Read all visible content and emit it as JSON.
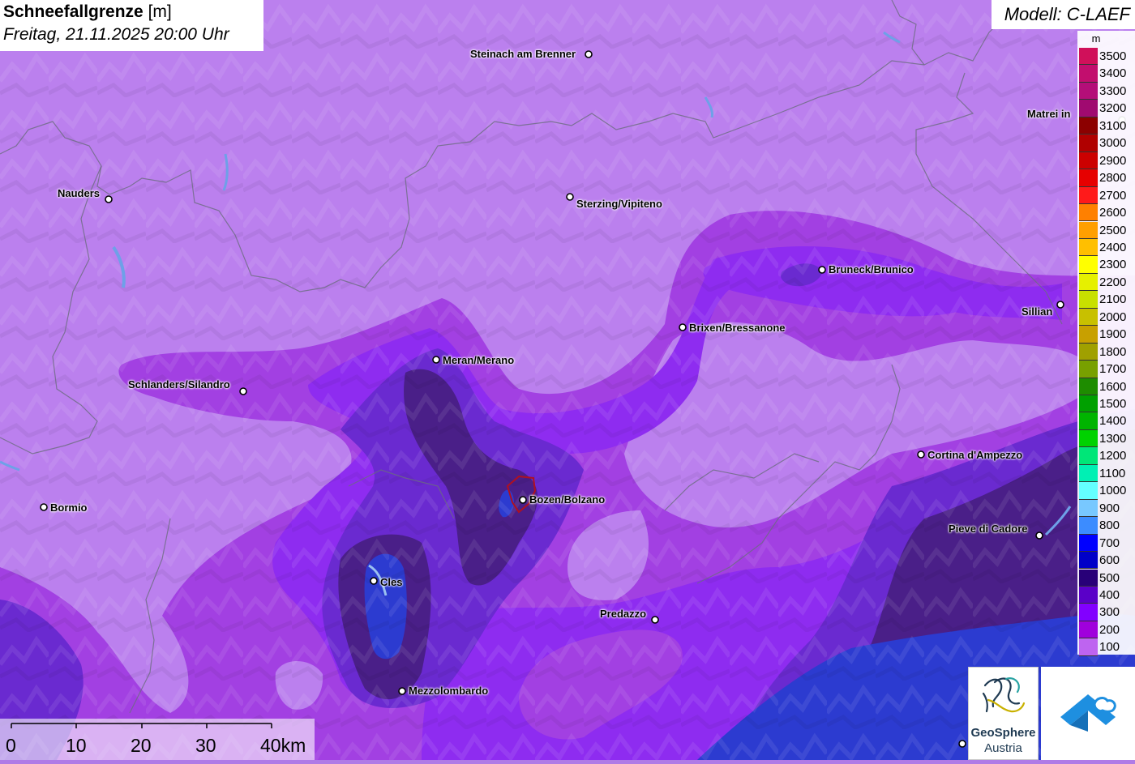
{
  "title": {
    "bold": "Schneefallgrenze",
    "unit": "[m]",
    "datetime": "Freitag, 21.11.2025 20:00 Uhr"
  },
  "model": "Modell: C-LAEF",
  "legend": {
    "unit": "m",
    "levels": [
      {
        "label": "3500",
        "color": "#d0105a"
      },
      {
        "label": "3400",
        "color": "#c20e6e"
      },
      {
        "label": "3300",
        "color": "#b40e78"
      },
      {
        "label": "3200",
        "color": "#a00a70"
      },
      {
        "label": "3100",
        "color": "#8c0000"
      },
      {
        "label": "3000",
        "color": "#b00000"
      },
      {
        "label": "2900",
        "color": "#cc0000"
      },
      {
        "label": "2800",
        "color": "#e60000"
      },
      {
        "label": "2700",
        "color": "#ff1a1a"
      },
      {
        "label": "2600",
        "color": "#ff8000"
      },
      {
        "label": "2500",
        "color": "#ff9f00"
      },
      {
        "label": "2400",
        "color": "#ffbf00"
      },
      {
        "label": "2300",
        "color": "#ffff00"
      },
      {
        "label": "2200",
        "color": "#e6f000"
      },
      {
        "label": "2100",
        "color": "#c8e000"
      },
      {
        "label": "2000",
        "color": "#c8c000"
      },
      {
        "label": "1900",
        "color": "#c8a000"
      },
      {
        "label": "1800",
        "color": "#a0a000"
      },
      {
        "label": "1700",
        "color": "#78a000"
      },
      {
        "label": "1600",
        "color": "#1e8c00"
      },
      {
        "label": "1500",
        "color": "#00a000"
      },
      {
        "label": "1400",
        "color": "#00b400"
      },
      {
        "label": "1300",
        "color": "#00d200"
      },
      {
        "label": "1200",
        "color": "#00e678"
      },
      {
        "label": "1100",
        "color": "#00f0b4"
      },
      {
        "label": "1000",
        "color": "#64ffff"
      },
      {
        "label": "900",
        "color": "#78c8ff"
      },
      {
        "label": "800",
        "color": "#3c8cff"
      },
      {
        "label": "700",
        "color": "#0000ff"
      },
      {
        "label": "600",
        "color": "#0000c8"
      },
      {
        "label": "500",
        "color": "#280078"
      },
      {
        "label": "400",
        "color": "#5a00c8"
      },
      {
        "label": "300",
        "color": "#8200ff"
      },
      {
        "label": "200",
        "color": "#a000dc"
      },
      {
        "label": "100",
        "color": "#be64f0"
      }
    ]
  },
  "scale_bar": {
    "labels": [
      "0",
      "10",
      "20",
      "30",
      "40km"
    ]
  },
  "cities": [
    {
      "name": "Steinach am Brenner"
    },
    {
      "name": "Matrei in Osttirol",
      "visible_text": "Matrei in"
    },
    {
      "name": "Nauders"
    },
    {
      "name": "Sterzing/Vipiteno"
    },
    {
      "name": "Bruneck/Brunico"
    },
    {
      "name": "Sillian"
    },
    {
      "name": "Brixen/Bressanone"
    },
    {
      "name": "Meran/Merano"
    },
    {
      "name": "Schlanders/Silandro"
    },
    {
      "name": "Cortina d'Ampezzo"
    },
    {
      "name": "Bormio"
    },
    {
      "name": "Bozen/Bolzano"
    },
    {
      "name": "Pieve di Cadore"
    },
    {
      "name": "Cles"
    },
    {
      "name": "Predazzo"
    },
    {
      "name": "Mezzolombardo"
    }
  ],
  "logos": {
    "geosphere_line1": "GeoSphere",
    "geosphere_line2": "Austria"
  },
  "colors": {
    "level_100": "#be7ef0",
    "level_200": "#a23ee0",
    "level_300": "#8e2af0",
    "level_400": "#6a2ad0",
    "level_500": "#4a1e8a",
    "level_600": "#2c3cc8"
  }
}
